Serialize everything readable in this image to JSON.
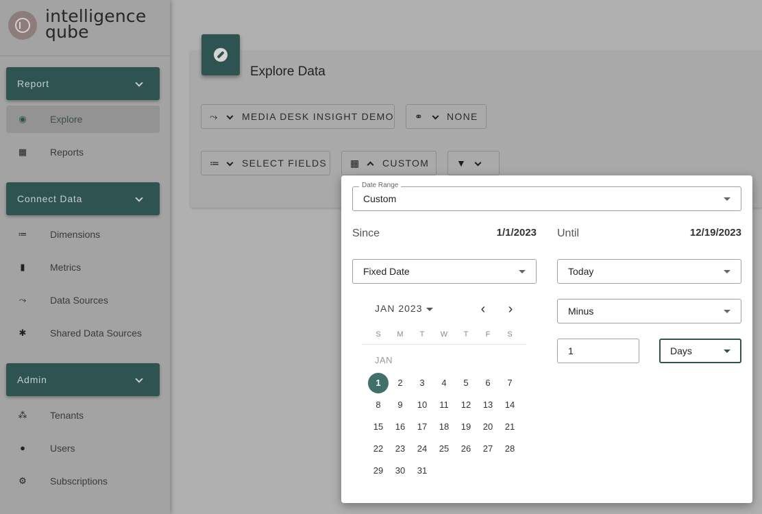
{
  "brand": {
    "line1": "intelligence",
    "line2": "qube"
  },
  "sidebar": {
    "sections": [
      {
        "title": "Report",
        "items": [
          {
            "label": "Explore",
            "icon": "compass-icon",
            "glyph": "◉",
            "active": true
          },
          {
            "label": "Reports",
            "icon": "table-icon",
            "glyph": "▦"
          }
        ]
      },
      {
        "title": "Connect Data",
        "items": [
          {
            "label": "Dimensions",
            "icon": "list-icon",
            "glyph": "≔"
          },
          {
            "label": "Metrics",
            "icon": "bar-chart-icon",
            "glyph": "▮"
          },
          {
            "label": "Data Sources",
            "icon": "merge-icon",
            "glyph": "⤳"
          },
          {
            "label": "Shared Data Sources",
            "icon": "hub-icon",
            "glyph": "✱"
          }
        ]
      },
      {
        "title": "Admin",
        "items": [
          {
            "label": "Tenants",
            "icon": "group-icon",
            "glyph": "⁂"
          },
          {
            "label": "Users",
            "icon": "person-icon",
            "glyph": "●"
          },
          {
            "label": "Subscriptions",
            "icon": "gear-icon",
            "glyph": "⚙"
          }
        ]
      }
    ]
  },
  "page": {
    "title": "Explore Data"
  },
  "toolbar": {
    "datasource_label": "MEDIA DESK INSIGHT DEMO",
    "link_label": "NONE",
    "fields_label": "SELECT FIELDS",
    "date_label": "CUSTOM"
  },
  "date_popup": {
    "range_legend": "Date Range",
    "range_value": "Custom",
    "since_label": "Since",
    "since_value": "1/1/2023",
    "until_label": "Until",
    "until_value": "12/19/2023",
    "since_mode": "Fixed Date",
    "until_mode": "Today",
    "offset_mode": "Minus",
    "offset_amount": "1",
    "offset_unit": "Days",
    "calendar": {
      "month_label": "JAN 2023",
      "section_label": "JAN",
      "weekdays": [
        "S",
        "M",
        "T",
        "W",
        "T",
        "F",
        "S"
      ],
      "days_in_month": 31,
      "first_weekday": 0,
      "selected_day": 1
    }
  },
  "colors": {
    "brand_dark": "#2f5350",
    "selected": "#3f706a"
  }
}
